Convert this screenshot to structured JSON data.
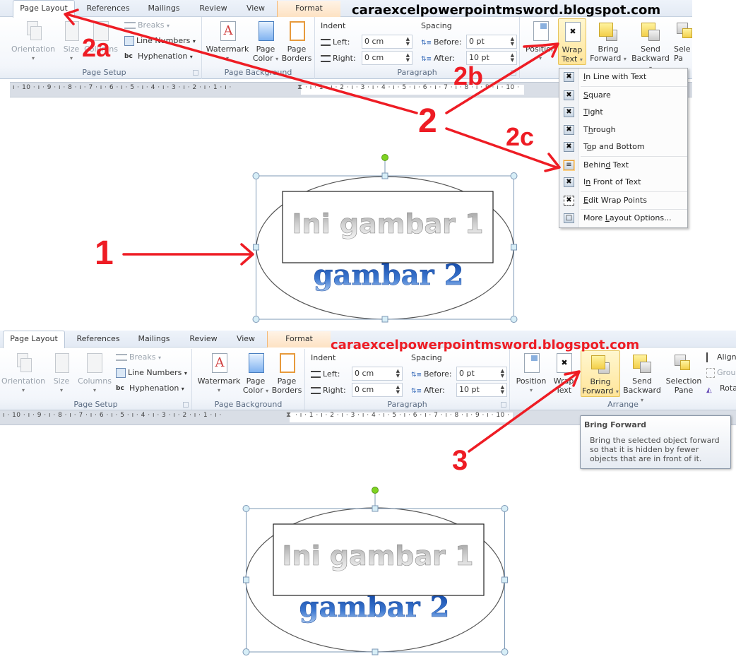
{
  "blog_title": "caraexcelpowerpointmsword.blogspot.com",
  "colors": {
    "annotation_red": "#ee1c24",
    "blog_title_top": "#000000",
    "blog_title_bottom": "#ee1c24",
    "selection_handle": "#cfe8f3",
    "rotate_handle": "#7ed321",
    "gambar2_blue": "#1f5bb8"
  },
  "tabs": [
    {
      "label": "Page Layout",
      "active": true
    },
    {
      "label": "References"
    },
    {
      "label": "Mailings"
    },
    {
      "label": "Review"
    },
    {
      "label": "View"
    },
    {
      "label": "Format",
      "contextual": true
    }
  ],
  "page_setup": {
    "group_label": "Page Setup",
    "orientation": "Orientation",
    "size": "Size",
    "columns": "Columns",
    "breaks": "Breaks",
    "line_numbers": "Line Numbers",
    "hyphenation": "Hyphenation"
  },
  "page_background": {
    "group_label": "Page Background",
    "watermark": "Watermark",
    "page_color_1": "Page",
    "page_color_2": "Color",
    "page_borders_1": "Page",
    "page_borders_2": "Borders"
  },
  "paragraph": {
    "group_label": "Paragraph",
    "indent_label": "Indent",
    "left_label": "Left:",
    "left_value": "0 cm",
    "right_label": "Right:",
    "right_value": "0 cm",
    "spacing_label": "Spacing",
    "before_label": "Before:",
    "before_value": "0 pt",
    "after_label": "After:",
    "after_value": "10 pt"
  },
  "arrange": {
    "group_label": "Arrange",
    "position": "Position",
    "wrap_1": "Wrap",
    "wrap_2": "Text",
    "bring_1": "Bring",
    "bring_2": "Forward",
    "send_1": "Send",
    "send_2": "Backward",
    "selection_1": "Selection",
    "selection_2": "Pane",
    "selection_1_cut": "Sele",
    "selection_2_cut": "Pa",
    "align": "Align",
    "group": "Group",
    "rotate": "Rotate"
  },
  "ruler": {
    "left_numbers": "ı · 10 · ı · 9 · ı · 8 · ı · 7 · ı · 6 · ı · 5 · ı · 4 · ı · 3 · ı · 2 · ı · 1 · ı ·",
    "right_numbers": "· ı · 1 · ı · 2 · ı · 3 · ı · 4 · ı · 5 · ı · 6 · ı · 7 · ı · 8 · ı · 9 · ı · 10 ·"
  },
  "wrap_menu": {
    "items": [
      {
        "label": "In Line with Text",
        "mnemonic": "I",
        "rest": "n Line with Text"
      },
      {
        "label": "Square",
        "mnemonic": "S",
        "rest": "quare"
      },
      {
        "label": "Tight",
        "mnemonic": "T",
        "rest": "ight"
      },
      {
        "label": "Through",
        "pre": "T",
        "mnemonic": "h",
        "rest": "rough"
      },
      {
        "label": "Top and Bottom",
        "pre": "T",
        "mnemonic": "o",
        "rest": "p and Bottom"
      },
      {
        "label": "Behind Text",
        "pre": "Behin",
        "mnemonic": "d",
        "rest": " Text",
        "selected": true
      },
      {
        "label": "In Front of Text",
        "pre": "I",
        "mnemonic": "n",
        "rest": " Front of Text"
      },
      {
        "label": "Edit Wrap Points",
        "mnemonic": "E",
        "rest": "dit Wrap Points"
      },
      {
        "label": "More Layout Options...",
        "pre": "More ",
        "mnemonic": "L",
        "rest": "ayout Options..."
      }
    ]
  },
  "tooltip": {
    "title": "Bring Forward",
    "body": "Bring the selected object forward so that it is hidden by fewer objects that are in front of it."
  },
  "figure": {
    "text1": "Ini gambar 1",
    "text2": "gambar 2"
  },
  "annotations": {
    "a1": "1",
    "a2": "2",
    "a2a": "2a",
    "a2b": "2b",
    "a2c": "2c",
    "a3": "3"
  }
}
